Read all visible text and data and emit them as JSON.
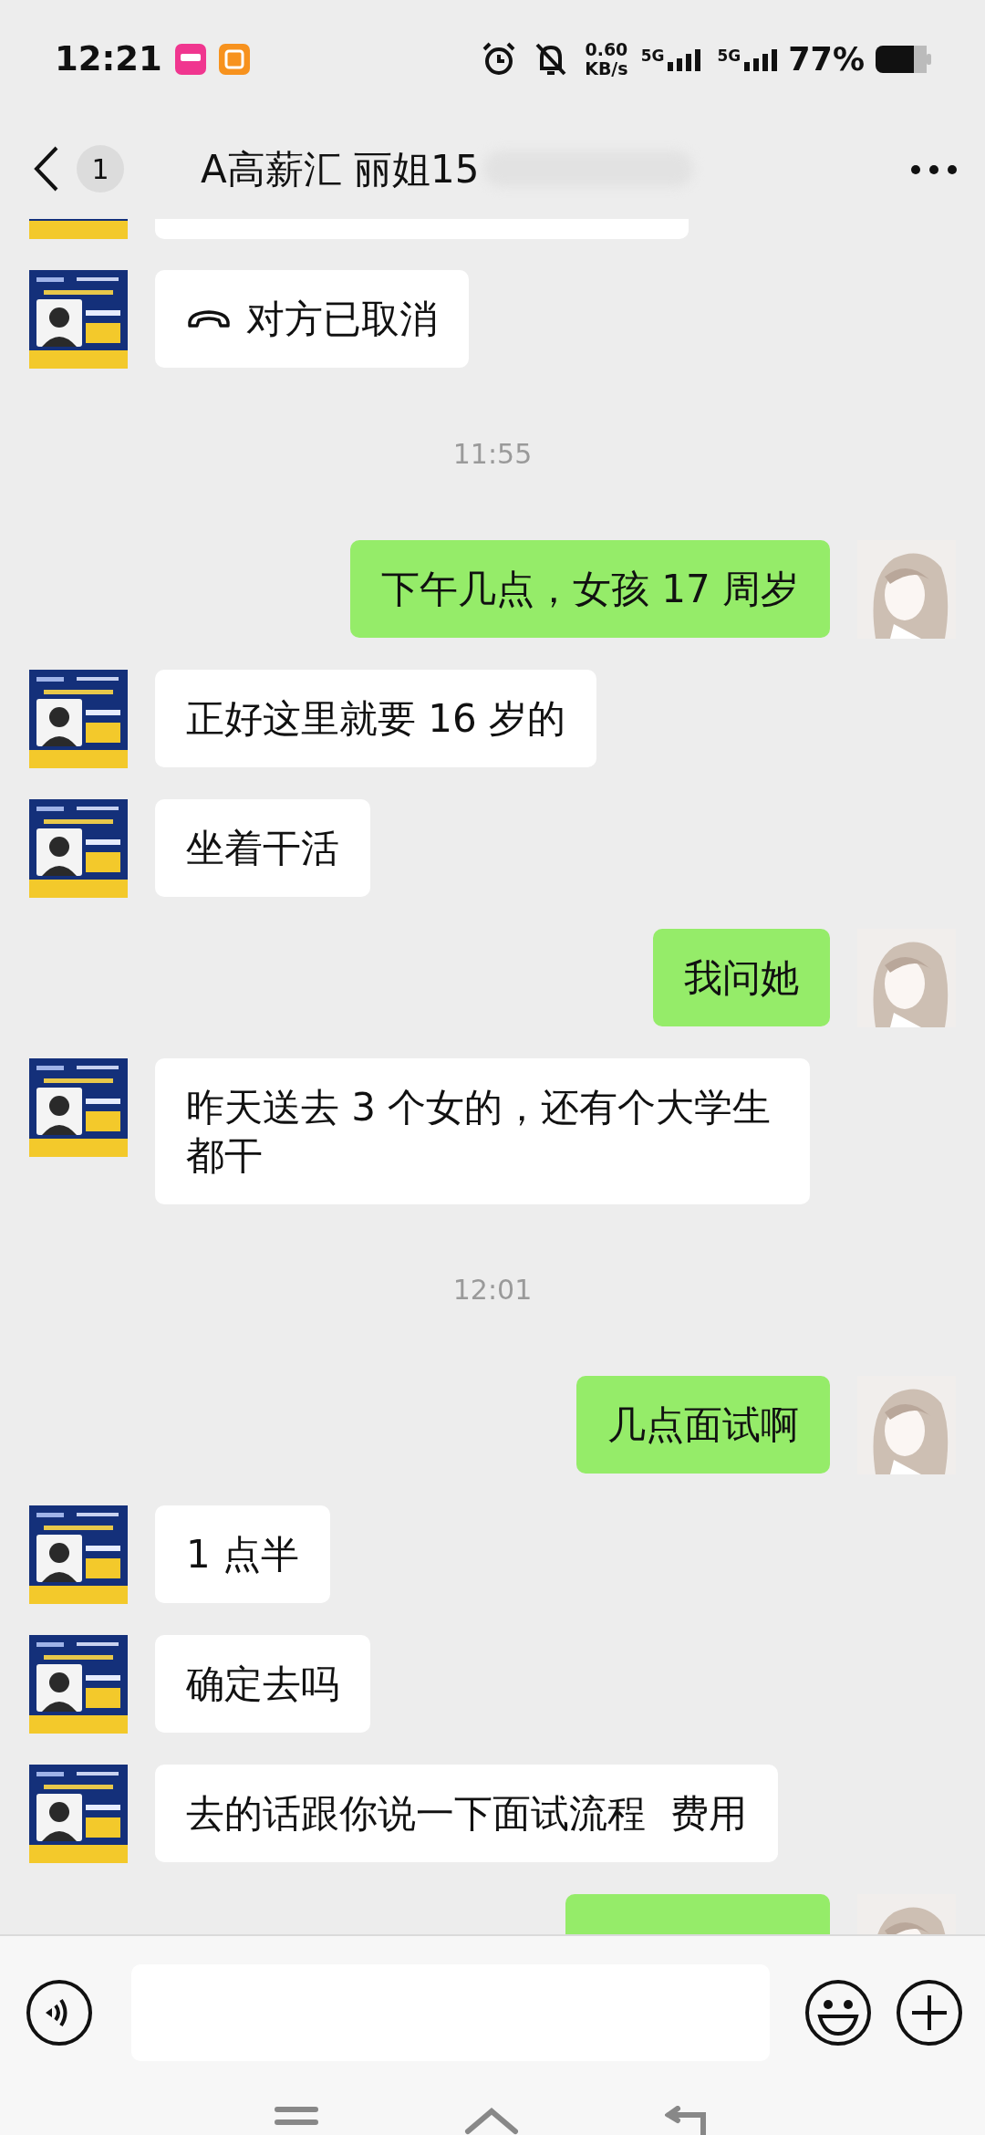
{
  "status_bar": {
    "time": "12:21",
    "net_speed": "0.60",
    "net_unit": "KB/s",
    "sim_1": "5G",
    "sim_2": "5G",
    "battery": "77%"
  },
  "header": {
    "back_count": "1",
    "title": "A高薪汇 丽姐15"
  },
  "messages": [
    {
      "kind": "partial",
      "outgoing": false
    },
    {
      "kind": "call",
      "outgoing": false,
      "text": "对方已取消"
    },
    {
      "kind": "time",
      "text": "11:55"
    },
    {
      "kind": "text",
      "outgoing": true,
      "text": "下午几点，女孩 17 周岁"
    },
    {
      "kind": "text",
      "outgoing": false,
      "text": "正好这里就要 16 岁的"
    },
    {
      "kind": "text",
      "outgoing": false,
      "text": "坐着干活"
    },
    {
      "kind": "text",
      "outgoing": true,
      "text": "我问她"
    },
    {
      "kind": "text",
      "outgoing": false,
      "text": "昨天送去 3 个女的，还有个大学生都干"
    },
    {
      "kind": "time",
      "text": "12:01"
    },
    {
      "kind": "text",
      "outgoing": true,
      "text": "几点面试啊"
    },
    {
      "kind": "text",
      "outgoing": false,
      "text": "1 点半"
    },
    {
      "kind": "text",
      "outgoing": false,
      "text": "确定去吗"
    },
    {
      "kind": "text",
      "outgoing": false,
      "text": "去的话跟你说一下面试流程  费用"
    },
    {
      "kind": "partial",
      "outgoing": true
    }
  ]
}
